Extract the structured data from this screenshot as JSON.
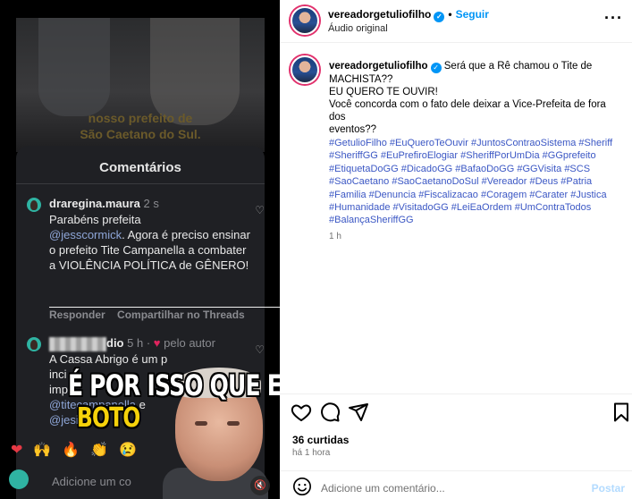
{
  "video": {
    "caption_line1": "nosso prefeito de",
    "caption_line2": "São Caetano do Sul.",
    "comments_title": "Comentários",
    "comments": [
      {
        "user": "draregina.maura",
        "time": "2 s",
        "text1": "Parabéns prefeita",
        "mention": "@jesscormick",
        "text2": ". Agora é preciso ensinar o prefeito Tite Campanella a combater a VIOLÊNCIA POLÍTICA de GÊNERO!",
        "reply": "Responder",
        "share": "Compartilhar no Threads"
      },
      {
        "user_suffix": "dio",
        "time": "5 h",
        "by_author": "pelo autor",
        "line1": "A Cassa Abrigo é um p",
        "line2": "inci",
        "line3": "imp",
        "mention1": "@titecampanella",
        "mention1_tail": " e",
        "mention2": "@jes",
        "mention2_tail": "ick"
      }
    ],
    "emojis": [
      "❤",
      "🙌",
      "🔥",
      "👏",
      "😢"
    ],
    "add_comment_placeholder": "Adicione um co",
    "overlay_line1": "É POR ISSO QUE EU",
    "overlay_line2": "BOTO",
    "mute_icon": "🔇"
  },
  "header": {
    "username": "vereadorgetuliofilho",
    "follow": "Seguir",
    "audio": "Áudio original",
    "more": "···"
  },
  "post": {
    "username": "vereadorgetuliofilho",
    "line1": "Será que a Rê chamou o Tite de",
    "line2": "MACHISTA??",
    "line3": "EU QUERO TE OUVIR!",
    "line4": "Você concorda com o fato dele deixar a Vice-Prefeita de fora dos",
    "line5": "eventos??",
    "hashtags": "#GetulioFilho #EuQueroTeOuvir #JuntosContraoSistema #Sheriff #SheriffGG #EuPrefiroElogiar #SheriffPorUmDia #GGprefeito #EtiquetaDoGG #DicadoGG #BafaoDoGG #GGVisita #SCS #SaoCaetano #SaoCaetanoDoSul #Vereador #Deus #Patria #Familia #Denuncia #Fiscalizacao #Coragem #Carater #Justica #Humanidade #VisitadoGG #LeiEaOrdem #UmContraTodos #BalançaSheriffGG",
    "time": "1 h"
  },
  "footer": {
    "likes": "36 curtidas",
    "posted": "há 1 hora",
    "comment_placeholder": "Adicione um comentário...",
    "post_button": "Postar"
  },
  "colors": {
    "accent": "#0095f6",
    "hashtag": "#3b57c4",
    "overlay_yellow": "#f6d20a"
  }
}
